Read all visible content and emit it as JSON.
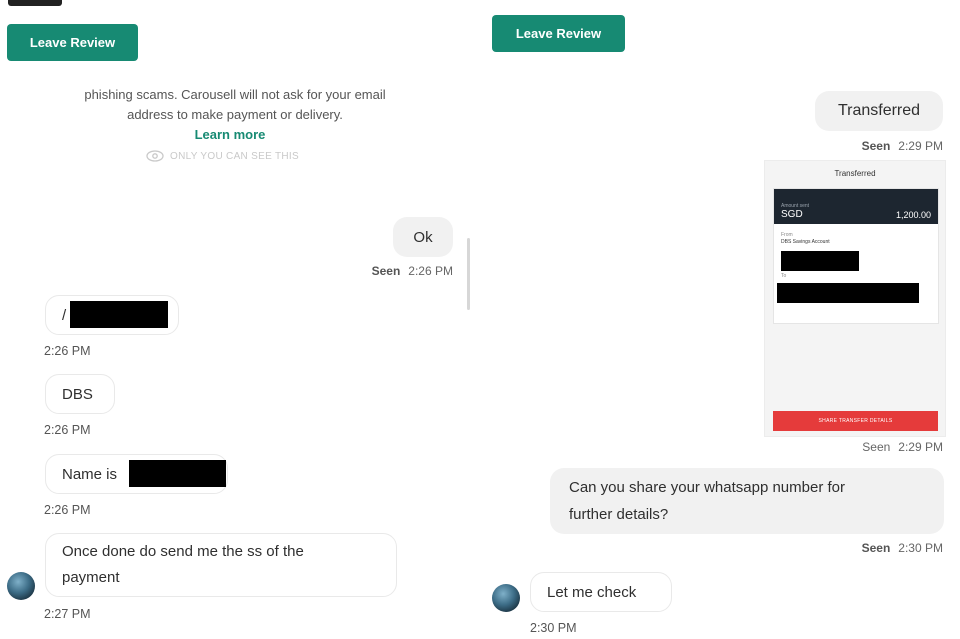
{
  "left": {
    "leave_review": "Leave Review",
    "notice_line1": "phishing scams. Carousell will not ask for your email",
    "notice_line2": "address to make payment or delivery.",
    "learn_more": "Learn more",
    "only_you": "ONLY YOU CAN SEE THIS",
    "messages": [
      {
        "side": "out",
        "text": "Ok",
        "seen": "Seen",
        "time": "2:26 PM"
      },
      {
        "side": "in",
        "text": "/",
        "time": "2:26 PM"
      },
      {
        "side": "in",
        "text": "DBS",
        "time": "2:26 PM"
      },
      {
        "side": "in",
        "text": "Name is",
        "time": "2:26 PM"
      },
      {
        "side": "in",
        "text_line1": "Once done do send me the ss of the",
        "text_line2": "payment",
        "time": "2:27 PM"
      }
    ]
  },
  "right": {
    "leave_review": "Leave Review",
    "messages": [
      {
        "side": "out",
        "text": "Transferred",
        "seen": "Seen",
        "time": "2:29 PM"
      },
      {
        "side": "out",
        "type": "image",
        "seen": "Seen",
        "time": "2:29 PM"
      },
      {
        "side": "out",
        "text_line1": "Can you share your whatsapp number for",
        "text_line2": "further details?",
        "seen": "Seen",
        "time": "2:30 PM"
      },
      {
        "side": "in",
        "text": "Let me check",
        "time": "2:30 PM"
      }
    ],
    "receipt": {
      "title": "Transferred",
      "amount_label": "Amount sent",
      "currency": "SGD",
      "amount": "1,200.00",
      "from_label": "From",
      "from_account": "DBS Savings Account",
      "to_label": "To",
      "share_button": "SHARE TRANSFER DETAILS"
    }
  },
  "colors": {
    "accent": "#178a73",
    "share": "#e53b3b",
    "receipt_bar": "#1d2630"
  },
  "icons": {
    "only_you": "eye-icon"
  }
}
